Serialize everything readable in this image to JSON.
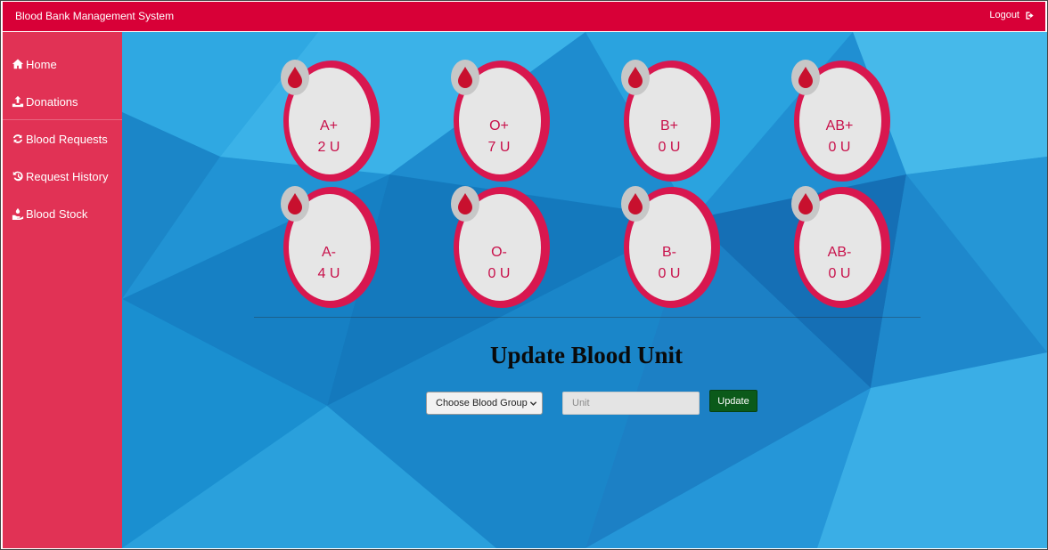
{
  "header": {
    "title": "Blood Bank Management System",
    "logout_label": "Logout"
  },
  "sidebar": {
    "items": [
      {
        "label": "Home",
        "icon": "home-icon"
      },
      {
        "label": "Donations",
        "icon": "upload-icon"
      },
      {
        "label": "Blood Requests",
        "icon": "refresh-icon"
      },
      {
        "label": "Request History",
        "icon": "history-icon"
      },
      {
        "label": "Blood Stock",
        "icon": "hand-holding-icon"
      }
    ]
  },
  "stock": [
    {
      "group": "A+",
      "units": "2 U"
    },
    {
      "group": "O+",
      "units": "7 U"
    },
    {
      "group": "B+",
      "units": "0 U"
    },
    {
      "group": "AB+",
      "units": "0 U"
    },
    {
      "group": "A-",
      "units": "4 U"
    },
    {
      "group": "O-",
      "units": "0 U"
    },
    {
      "group": "B-",
      "units": "0 U"
    },
    {
      "group": "AB-",
      "units": "0 U"
    }
  ],
  "update_form": {
    "title": "Update Blood Unit",
    "select_value": "Choose Blood Group",
    "unit_placeholder": "Unit",
    "submit_label": "Update"
  },
  "colors": {
    "header_bg": "#d80037",
    "sidebar_bg": "#e13255",
    "card_ring": "#d8174f",
    "drop": "#c8102e",
    "update_button": "#0b5a1a"
  }
}
